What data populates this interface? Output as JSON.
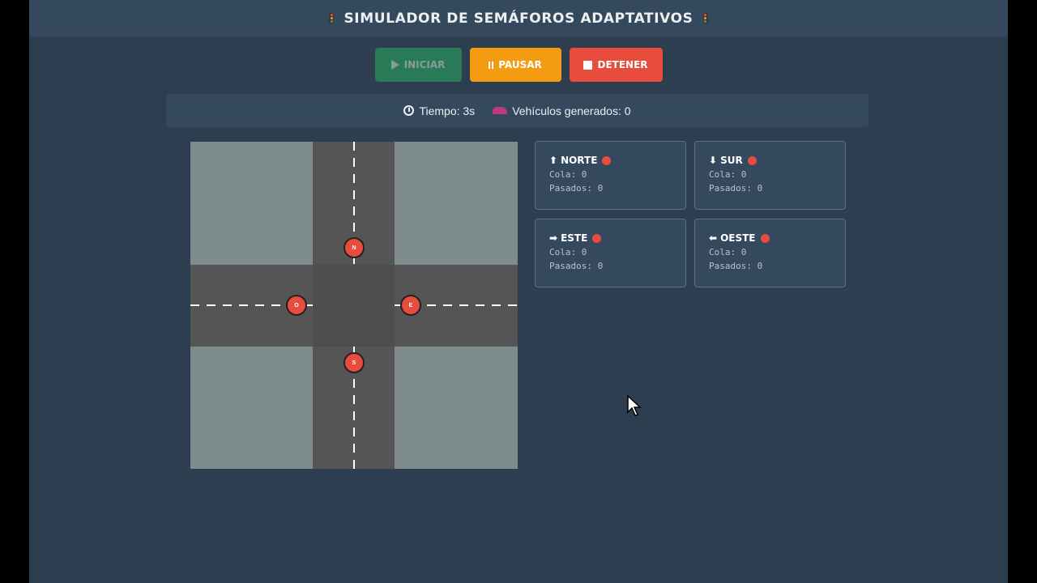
{
  "header": {
    "title": "SIMULADOR DE SEMÁFOROS ADAPTATIVOS",
    "light_colors": [
      "#e74c3c",
      "#f39c12",
      "#27ae60"
    ]
  },
  "controls": {
    "start": {
      "label": "INICIAR",
      "icon": "play-icon",
      "disabled": true
    },
    "pause": {
      "label": "PAUSAR",
      "icon": "pause-icon"
    },
    "stop": {
      "label": "DETENER",
      "icon": "stop-icon"
    }
  },
  "stats": {
    "time": "Tiempo: 3s",
    "time_icon": "stopwatch-icon",
    "vehicles": "Vehículos generados: 0",
    "vehicles_icon": "car-icon"
  },
  "intersection": {
    "lights": [
      {
        "id": "north",
        "letter": "N",
        "state": "red"
      },
      {
        "id": "west",
        "letter": "O",
        "state": "red"
      },
      {
        "id": "east",
        "letter": "E",
        "state": "red"
      },
      {
        "id": "south",
        "letter": "S",
        "state": "red"
      }
    ]
  },
  "directions": [
    {
      "name": "NORTE",
      "arrow": "⬆",
      "state": "red",
      "queue": "Cola: 0",
      "passed": "Pasados: 0"
    },
    {
      "name": "SUR",
      "arrow": "⬇",
      "state": "red",
      "queue": "Cola: 0",
      "passed": "Pasados: 0"
    },
    {
      "name": "ESTE",
      "arrow": "➡",
      "state": "red",
      "queue": "Cola: 0",
      "passed": "Pasados: 0"
    },
    {
      "name": "OESTE",
      "arrow": "⬅",
      "state": "red",
      "queue": "Cola: 0",
      "passed": "Pasados: 0"
    }
  ],
  "colors": {
    "background": "#2c3e50",
    "panel": "#34495e",
    "red": "#e74c3c",
    "green": "#27ae60",
    "orange": "#f39c12",
    "road": "#555555",
    "grass": "#7f8c8d"
  }
}
